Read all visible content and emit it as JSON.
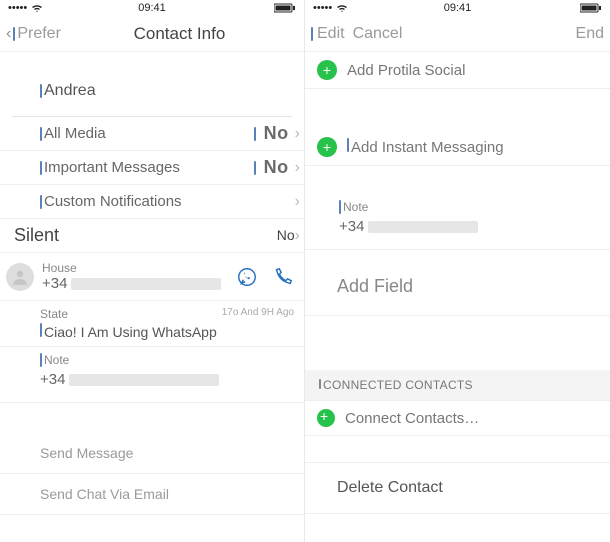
{
  "left": {
    "status": {
      "time": "09:41"
    },
    "nav": {
      "back": "Prefer",
      "title": "Contact Info"
    },
    "contact_name": "Andrea",
    "rows": {
      "all_media": {
        "label": "All Media",
        "value": "No"
      },
      "important": {
        "label": "Important Messages",
        "value": "No"
      },
      "custom_notif": {
        "label": "Custom Notifications"
      },
      "silent": {
        "label": "Silent",
        "value": "No"
      }
    },
    "phone": {
      "label": "House",
      "prefix": "+34"
    },
    "state": {
      "label": "State",
      "text": "Ciao! I Am Using WhatsApp",
      "timestamp": "17o And 9H Ago"
    },
    "note": {
      "label": "Note",
      "prefix": "+34"
    },
    "actions": {
      "send_message": "Send Message",
      "send_email": "Send Chat Via Email"
    }
  },
  "right": {
    "status": {
      "time": "09:41"
    },
    "nav": {
      "edit": "Edit",
      "cancel": "Cancel",
      "end": "End"
    },
    "add_profile": "Add Protila Social",
    "add_im": "Add Instant Messaging",
    "note": {
      "label": "Note",
      "prefix": "+34"
    },
    "add_field": "Add Field",
    "connected_header": "CONNECTED CONTACTS",
    "connect_contacts": "Connect Contacts…",
    "delete_contact": "Delete Contact"
  }
}
